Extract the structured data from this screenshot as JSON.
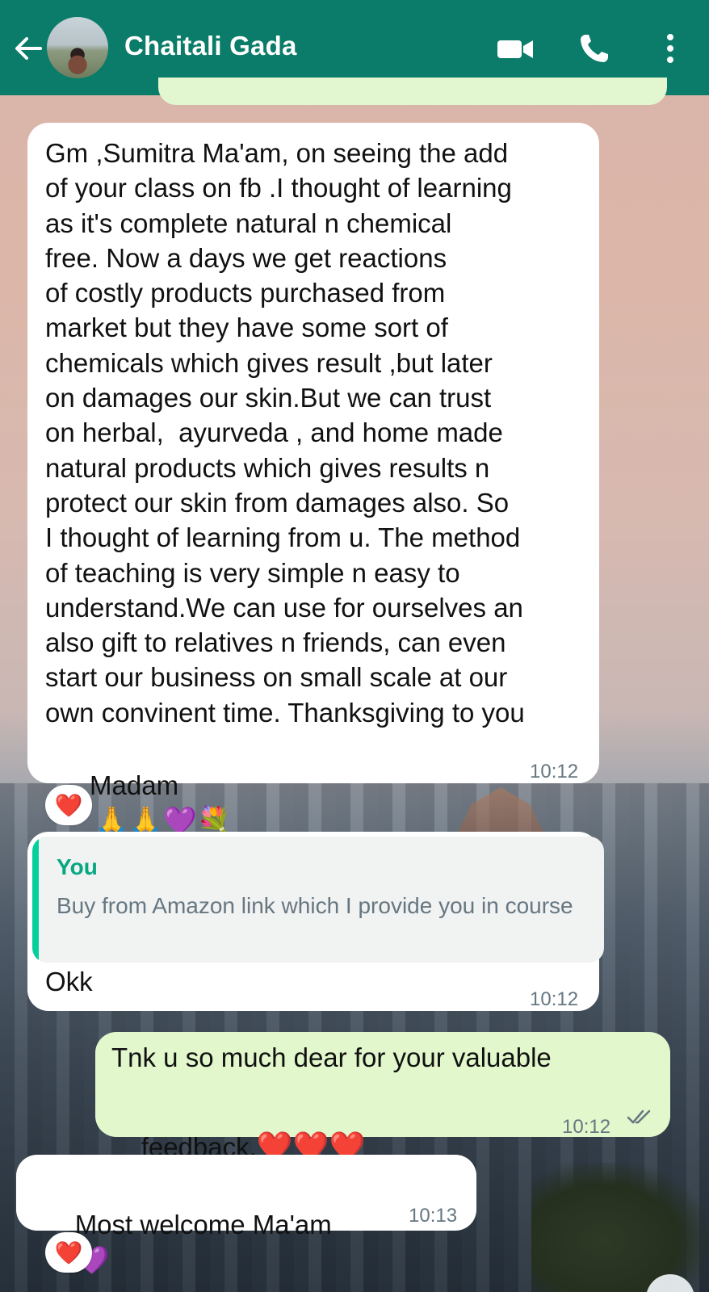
{
  "header": {
    "contact_name": "Chaitali Gada",
    "color": "#0a7c69"
  },
  "messages": [
    {
      "type": "received",
      "text_lines": [
        "Gm ,Sumitra Ma'am, on seeing the add",
        "of your class on fb .I thought of learning",
        "as it's complete natural n chemical",
        "free. Now a days we get reactions",
        "of costly products purchased from",
        "market but they have some sort of",
        "chemicals which gives result ,but later",
        "on damages our skin.But we can trust",
        "on herbal,  ayurveda , and home made",
        "natural products which gives results n",
        "protect our skin from damages also. So",
        "I thought of learning from u. The method",
        "of teaching is very simple n easy to",
        "understand.We can use for ourselves an",
        "also gift to relatives n friends, can even",
        "start our business on small scale at our",
        "own convinent time. Thanksgiving to you"
      ],
      "last_line": "Madam",
      "emojis": [
        "🙏",
        "🙏",
        "💜",
        "💐"
      ],
      "time": "10:12",
      "reaction": "❤️"
    },
    {
      "type": "received",
      "quote": {
        "author": "You",
        "text": "Buy from Amazon link which I provide you in course"
      },
      "text": "Okk",
      "time": "10:12"
    },
    {
      "type": "sent",
      "line1": "Tnk u so much dear for your valuable",
      "line2": "feedback.",
      "emojis": [
        "❤️",
        "❤️",
        "❤️"
      ],
      "time": "10:12",
      "status": "read"
    },
    {
      "type": "received",
      "text": "Most welcome Ma'am",
      "emoji": "💜",
      "time": "10:13",
      "reaction": "❤️"
    }
  ],
  "colors": {
    "sent_bubble": "#e2f7cb",
    "received_bubble": "#ffffff",
    "quote_accent": "#06cf9c",
    "time_text": "#667781"
  },
  "icons": [
    "back-arrow-icon",
    "video-call-icon",
    "phone-icon",
    "more-options-icon"
  ]
}
